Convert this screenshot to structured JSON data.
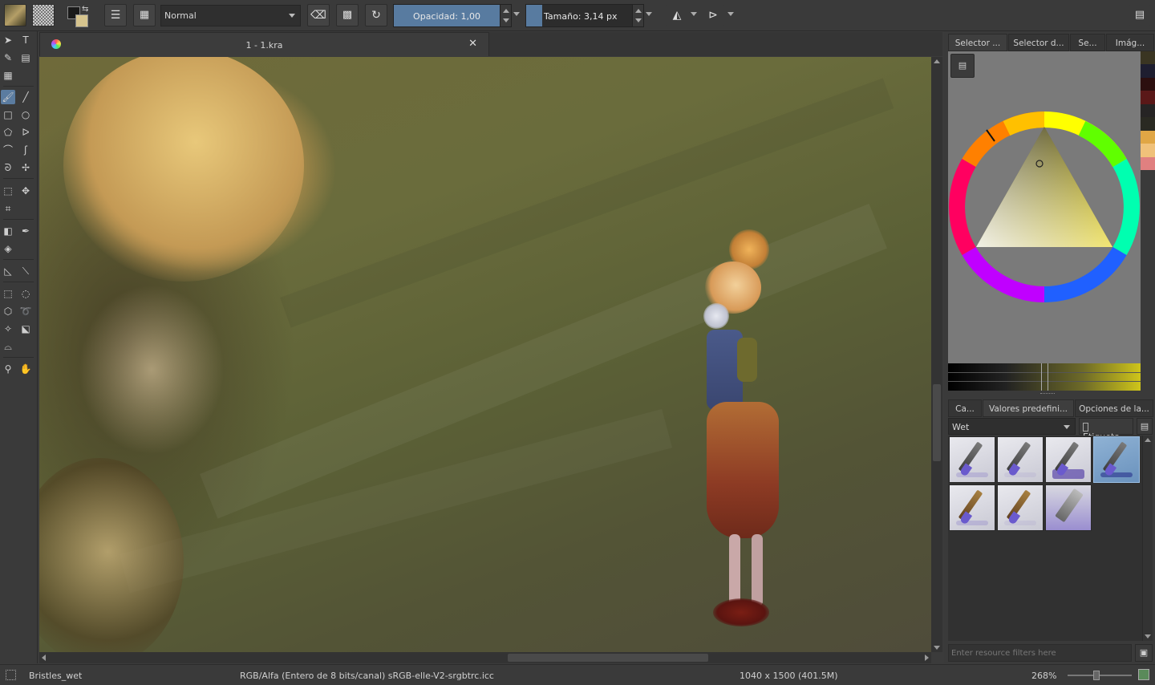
{
  "toolbar": {
    "blend_mode": "Normal",
    "opacity_label": "Opacidad:",
    "opacity_value": "1,00",
    "opacity_fraction": 1.0,
    "size_label": "Tamaño:",
    "size_value": "3,14 px",
    "size_fraction": 0.14
  },
  "document": {
    "tab_title": "1 - 1.kra"
  },
  "dock": {
    "top_tabs": [
      "Selector ...",
      "Selector d...",
      "Se...",
      "Imág..."
    ],
    "palette_colors": [
      "#3a3522",
      "#1e1e30",
      "#2c0f0f",
      "#5a1818",
      "#262424",
      "#2a2a22",
      "#e0a645",
      "#f0c17a",
      "#e08080"
    ],
    "bottom_tabs": [
      "Ca...",
      "Valores predefini...",
      "Opciones de la..."
    ],
    "preset_group": "Wet",
    "tag_label": "Etiqueta",
    "filter_placeholder": "Enter resource filters here"
  },
  "statusbar": {
    "preset_name": "Bristles_wet",
    "color_space": "RGB/Alfa (Entero de 8 bits/canal)  sRGB-elle-V2-srgbtrc.icc",
    "dimensions": "1040 x 1500 (401.5M)",
    "zoom": "268%"
  },
  "colors": {
    "accent": "#587ba0",
    "panel_bg": "#3a3a3a",
    "foreground_color": "#1a1a1a",
    "background_color": "#d6c48e"
  }
}
